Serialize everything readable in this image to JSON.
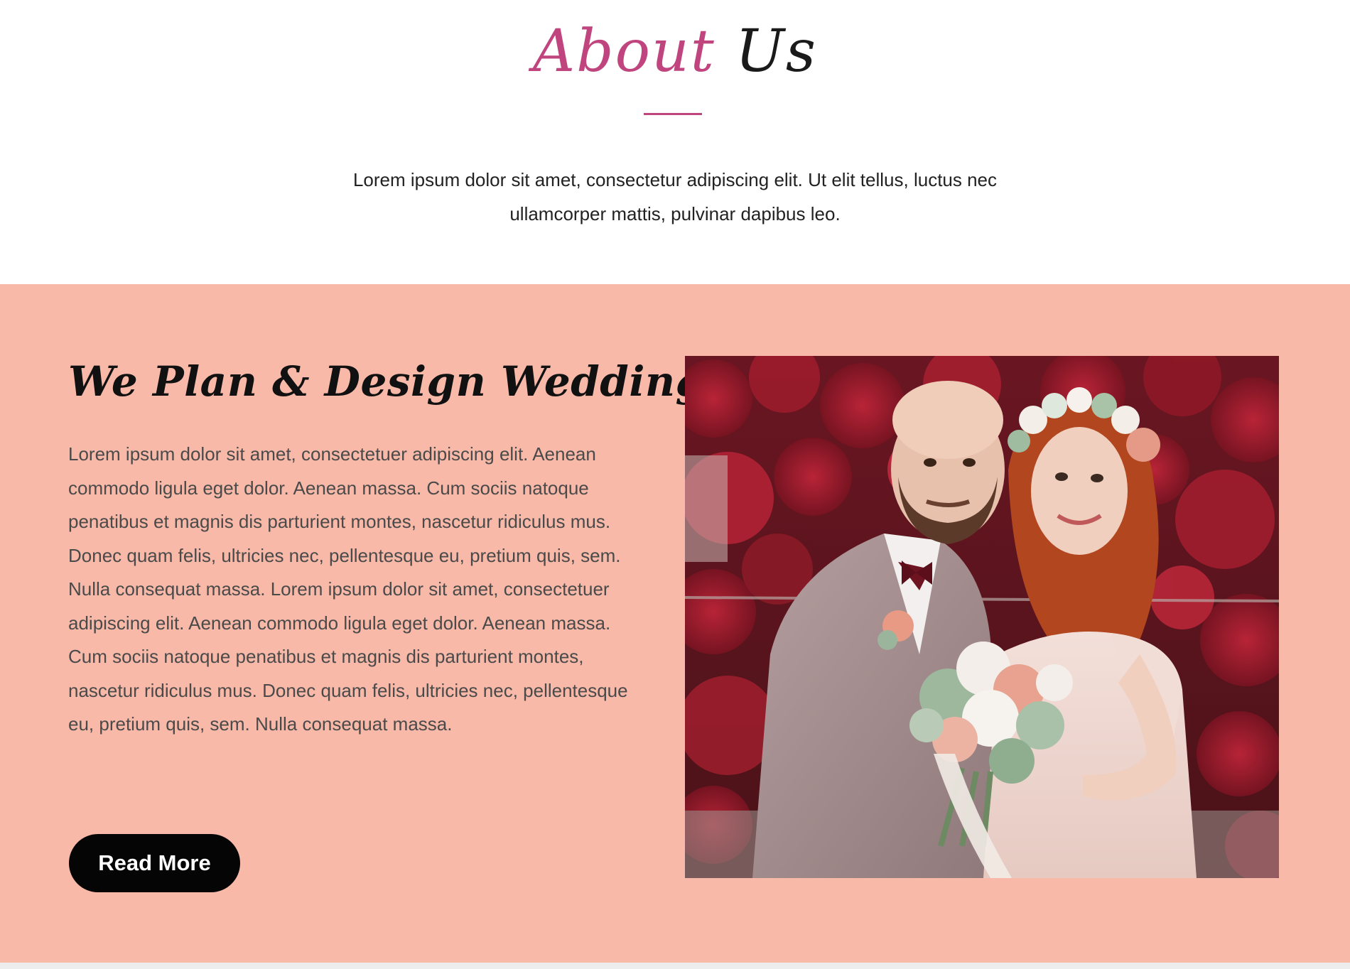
{
  "about": {
    "title_part1": "About",
    "title_part2": "Us",
    "intro_line1": "Lorem ipsum dolor sit amet, consectetur adipiscing elit. Ut elit tellus, luctus nec",
    "intro_line2": "ullamcorper mattis, pulvinar dapibus leo."
  },
  "feature": {
    "heading": "We Plan & Design Weddings",
    "body": "Lorem ipsum dolor sit amet, consectetuer adipiscing elit. Aenean commodo ligula eget dolor. Aenean massa. Cum sociis natoque penatibus et magnis dis parturient montes, nascetur ridiculus mus. Donec quam felis, ultricies nec, pellentesque eu, pretium quis, sem. Nulla consequat massa. Lorem ipsum dolor sit amet, consectetuer adipiscing elit. Aenean commodo ligula eget dolor. Aenean massa. Cum sociis natoque penatibus et magnis dis parturient montes, nascetur ridiculus mus. Donec quam felis, ultricies nec, pellentesque eu, pretium quis, sem. Nulla consequat massa.",
    "button_label": "Read More",
    "photo_icon": "wedding-couple-photo"
  },
  "colors": {
    "accent_pink": "#c0457f",
    "band_salmon": "#f8b9a8",
    "button_black": "#050505",
    "heading_dark": "#111111"
  }
}
